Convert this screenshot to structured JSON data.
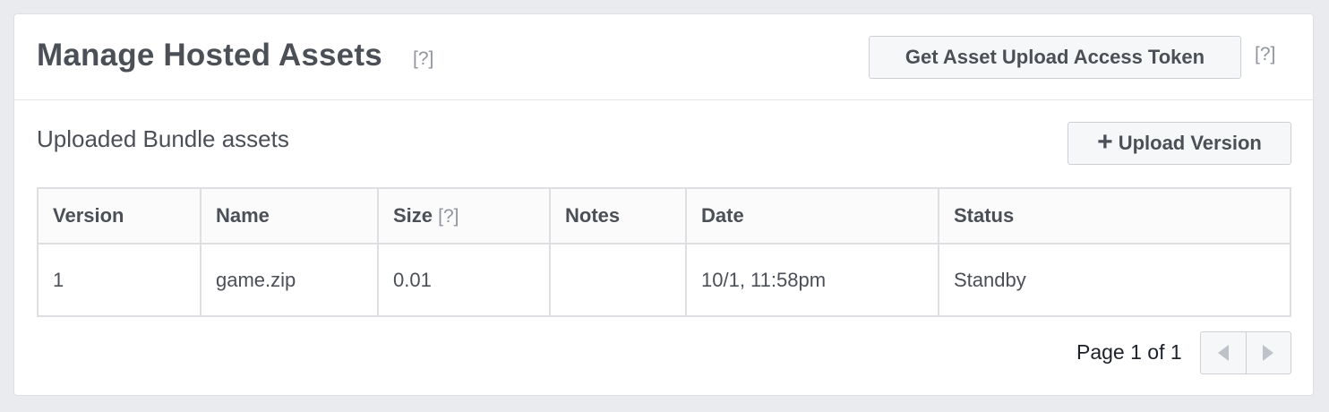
{
  "header": {
    "title": "Manage Hosted Assets",
    "title_help": "[?]",
    "token_button": "Get Asset Upload Access Token",
    "token_help": "[?]"
  },
  "section": {
    "title": "Uploaded Bundle assets",
    "upload_button": "Upload Version",
    "upload_icon": "plus-icon"
  },
  "table": {
    "columns": [
      "Version",
      "Name",
      "Size",
      "Notes",
      "Date",
      "Status"
    ],
    "size_help": "[?]",
    "rows": [
      {
        "version": "1",
        "name": "game.zip",
        "size": "0.01",
        "notes": "",
        "date": "10/1, 11:58pm",
        "status": "Standby"
      }
    ]
  },
  "pagination": {
    "label": "Page 1 of 1",
    "prev_icon": "chevron-left-icon",
    "next_icon": "chevron-right-icon"
  }
}
